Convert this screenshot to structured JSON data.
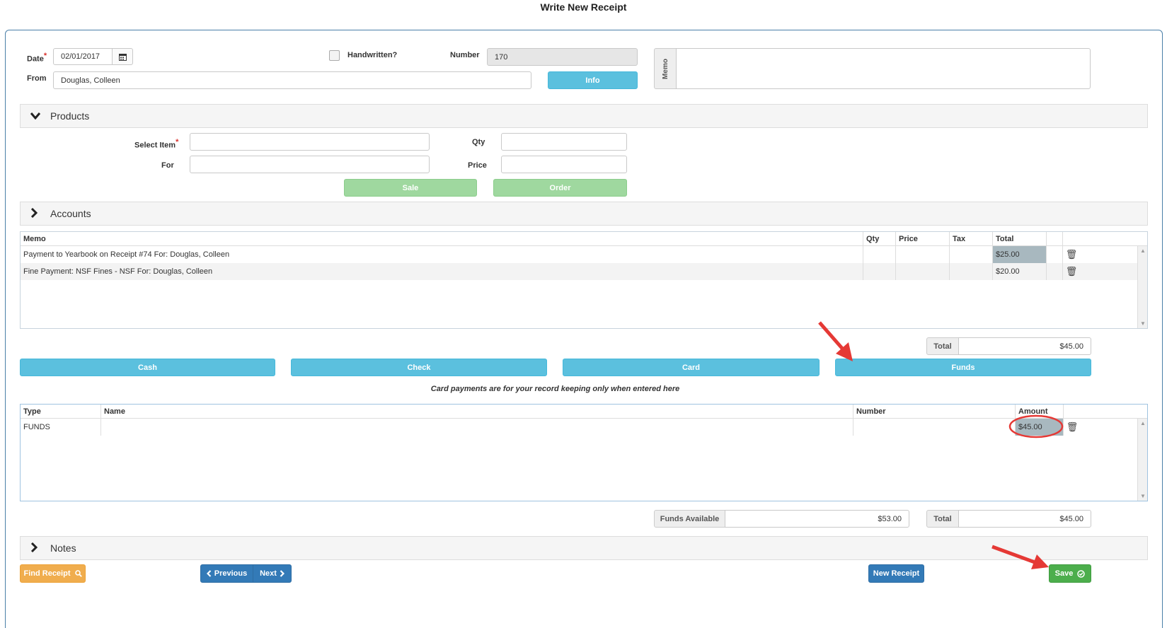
{
  "page": {
    "title": "Write New Receipt"
  },
  "header": {
    "date_label": "Date",
    "required_mark": "*",
    "date_value": "02/01/2017",
    "handwritten_label": "Handwritten?",
    "number_label": "Number",
    "number_value": "170",
    "from_label": "From",
    "from_value": "Douglas, Colleen",
    "info_button": "Info",
    "memo_label": "Memo",
    "memo_value": ""
  },
  "products": {
    "section_title": "Products",
    "select_item_label": "Select Item",
    "for_label": "For",
    "qty_label": "Qty",
    "price_label": "Price",
    "sale_button": "Sale",
    "order_button": "Order"
  },
  "accounts": {
    "section_title": "Accounts",
    "columns": [
      "Memo",
      "Qty",
      "Price",
      "Tax",
      "Total"
    ],
    "rows": [
      {
        "memo": "Payment to Yearbook on Receipt #74 For: Douglas, Colleen",
        "qty": "",
        "price": "",
        "tax": "",
        "total": "$25.00"
      },
      {
        "memo": "Fine Payment: NSF Fines - NSF For: Douglas, Colleen",
        "qty": "",
        "price": "",
        "tax": "",
        "total": "$20.00"
      }
    ],
    "total_label": "Total",
    "total_value": "$45.00"
  },
  "payment_buttons": {
    "cash": "Cash",
    "check": "Check",
    "card": "Card",
    "funds": "Funds",
    "card_note": "Card payments are for your record keeping only when entered here"
  },
  "payments": {
    "columns": [
      "Type",
      "Name",
      "Number",
      "Amount"
    ],
    "rows": [
      {
        "type": "FUNDS",
        "name": "",
        "number": "",
        "amount": "$45.00"
      }
    ],
    "funds_available_label": "Funds Available",
    "funds_available_value": "$53.00",
    "total_label": "Total",
    "total_value": "$45.00"
  },
  "notes": {
    "section_title": "Notes"
  },
  "footer": {
    "find_receipt": "Find Receipt",
    "previous": "Previous",
    "next": "Next",
    "new_receipt": "New Receipt",
    "save": "Save"
  },
  "colors": {
    "info": "#5bc0de",
    "success": "#4cae4c",
    "warning": "#f0ad4e",
    "primary": "#337ab7",
    "annotation": "#e53935"
  },
  "icons": [
    "calendar-icon",
    "chevron-down-icon",
    "chevron-right-icon",
    "trash-icon",
    "search-icon",
    "chevron-left-icon",
    "check-circle-icon"
  ]
}
